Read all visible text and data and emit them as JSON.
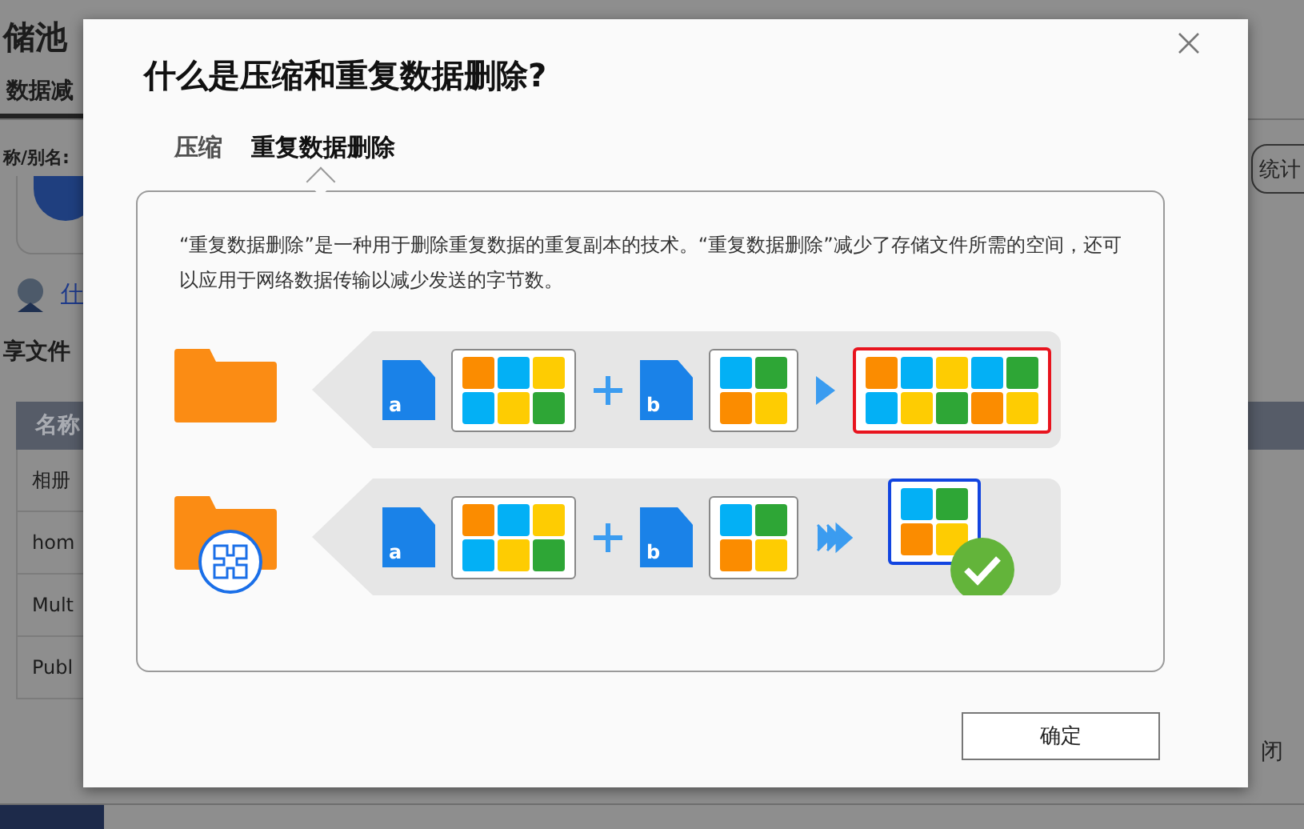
{
  "background_page": {
    "title": "储池",
    "tab": "数据减",
    "name_label": "称/别名:",
    "link": "什",
    "section_title": "享文件",
    "table": {
      "columns": [
        "名称"
      ],
      "rows": [
        "相册",
        "hom",
        "Mult",
        "Publ"
      ]
    },
    "stats_button": "统计",
    "close_button": "闭"
  },
  "dialog": {
    "title": "什么是压缩和重复数据删除?",
    "tabs": [
      {
        "label": "压缩",
        "selected": false
      },
      {
        "label": "重复数据删除",
        "selected": true
      }
    ],
    "description": "“重复数据删除”是一种用于删除重复数据的重复副本的技术。“重复数据删除”减少了存储文件所需的空间，还可以应用于网络数据传输以减少发送的字节数。",
    "diagram_rows": [
      {
        "kind": "stored",
        "files": [
          "a",
          "b"
        ]
      },
      {
        "kind": "deduplicated",
        "files": [
          "a",
          "b"
        ]
      }
    ],
    "ok_button": "确定"
  }
}
